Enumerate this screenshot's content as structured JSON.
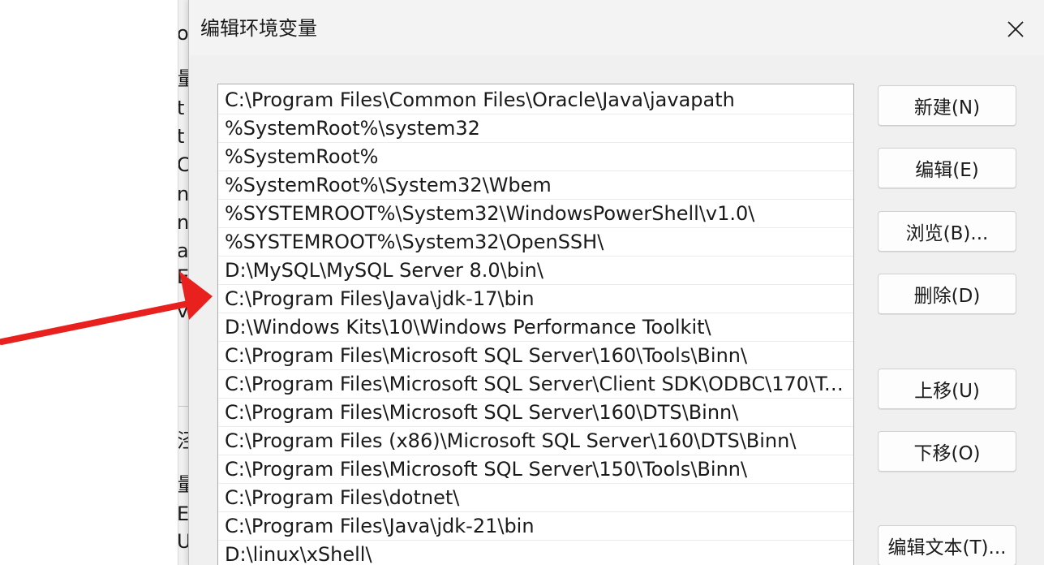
{
  "dialog": {
    "title": "编辑环境变量",
    "close_icon": "close-icon",
    "path_entries": [
      "C:\\Program Files\\Common Files\\Oracle\\Java\\javapath",
      "%SystemRoot%\\system32",
      "%SystemRoot%",
      "%SystemRoot%\\System32\\Wbem",
      "%SYSTEMROOT%\\System32\\WindowsPowerShell\\v1.0\\",
      "%SYSTEMROOT%\\System32\\OpenSSH\\",
      "D:\\MySQL\\MySQL Server 8.0\\bin\\",
      "C:\\Program Files\\Java\\jdk-17\\bin",
      "D:\\Windows Kits\\10\\Windows Performance Toolkit\\",
      "C:\\Program Files\\Microsoft SQL Server\\160\\Tools\\Binn\\",
      "C:\\Program Files\\Microsoft SQL Server\\Client SDK\\ODBC\\170\\Too...",
      "C:\\Program Files\\Microsoft SQL Server\\160\\DTS\\Binn\\",
      "C:\\Program Files (x86)\\Microsoft SQL Server\\160\\DTS\\Binn\\",
      "C:\\Program Files\\Microsoft SQL Server\\150\\Tools\\Binn\\",
      "C:\\Program Files\\dotnet\\",
      "C:\\Program Files\\Java\\jdk-21\\bin",
      "D:\\linux\\xShell\\"
    ],
    "buttons": {
      "new": "新建(N)",
      "edit": "编辑(E)",
      "browse": "浏览(B)...",
      "delete": "删除(D)",
      "move_up": "上移(U)",
      "move_down": "下移(O)",
      "edit_text": "编辑文本(T)..."
    }
  },
  "background_window": {
    "visible_fragments": [
      "ov",
      "量",
      "t",
      "t",
      "C",
      "n",
      "n",
      "a",
      "E",
      "v",
      "泾",
      "量",
      "E",
      "U"
    ]
  },
  "annotation": {
    "arrow_color": "#e8201e"
  }
}
